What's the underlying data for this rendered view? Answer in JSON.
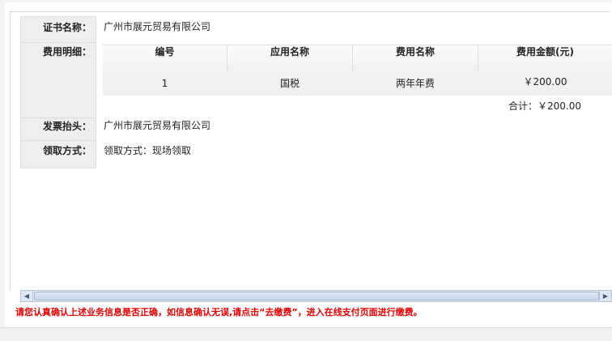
{
  "form": {
    "cert_name_label": "证书名称：",
    "cert_name_value": "广州市展元贸易有限公司",
    "fee_detail_label": "费用明细：",
    "invoice_title_label": "发票抬头：",
    "invoice_title_value": "广州市展元贸易有限公司",
    "pickup_label": "领取方式：",
    "pickup_value": "领取方式：现场领取"
  },
  "fee_table": {
    "headers": [
      "编号",
      "应用名称",
      "费用名称",
      "费用金额(元)"
    ],
    "rows": [
      [
        "1",
        "国税",
        "两年年费",
        "￥200.00"
      ]
    ],
    "total": "合计：￥200.00"
  },
  "scrollbar": {
    "left_arrow": "◀",
    "right_arrow": "▶"
  },
  "notice": "请您认真确认上述业务信息是否正确，如信息确认无误,请点击“去缴费”，进入在线支付页面进行缴费。"
}
